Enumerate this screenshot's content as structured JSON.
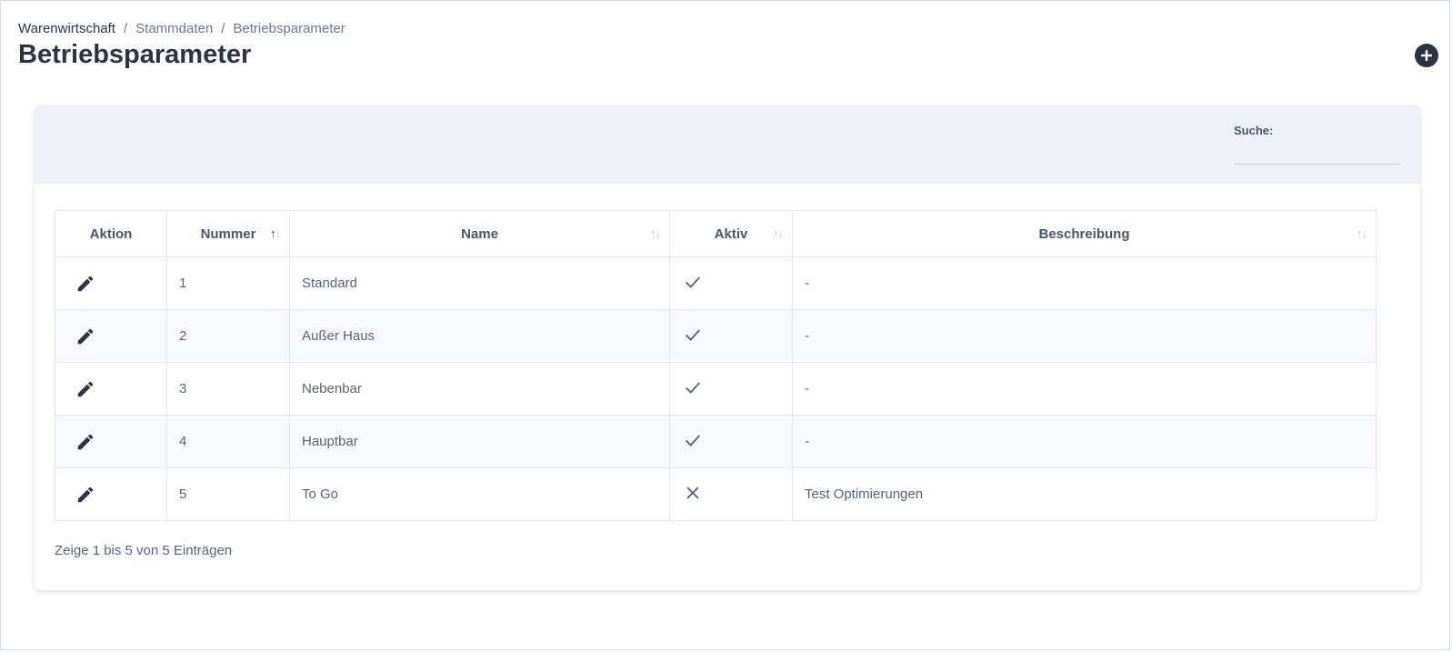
{
  "breadcrumb": [
    "Warenwirtschaft",
    "Stammdaten",
    "Betriebsparameter"
  ],
  "page_title": "Betriebsparameter",
  "search": {
    "label": "Suche:",
    "value": "",
    "placeholder": ""
  },
  "table": {
    "columns": [
      "Aktion",
      "Nummer",
      "Name",
      "Aktiv",
      "Beschreibung"
    ],
    "rows": [
      {
        "nummer": "1",
        "name": "Standard",
        "aktiv": true,
        "beschreibung": "-"
      },
      {
        "nummer": "2",
        "name": "Außer Haus",
        "aktiv": true,
        "beschreibung": "-"
      },
      {
        "nummer": "3",
        "name": "Nebenbar",
        "aktiv": true,
        "beschreibung": "-"
      },
      {
        "nummer": "4",
        "name": "Hauptbar",
        "aktiv": true,
        "beschreibung": "-"
      },
      {
        "nummer": "5",
        "name": "To Go",
        "aktiv": false,
        "beschreibung": "Test Optimierungen"
      }
    ]
  },
  "footer_info": "Zeige 1 bis 5 von 5 Einträgen",
  "icons": {
    "add": "plus-circle-icon",
    "edit": "pencil-icon",
    "active": "check-icon",
    "inactive": "close-icon",
    "sort": "sort-arrows-icon"
  },
  "colors": {
    "primary_dark": "#2b3445",
    "header_bg": "#edf1f7",
    "stripe_bg": "#f7f9fc"
  }
}
